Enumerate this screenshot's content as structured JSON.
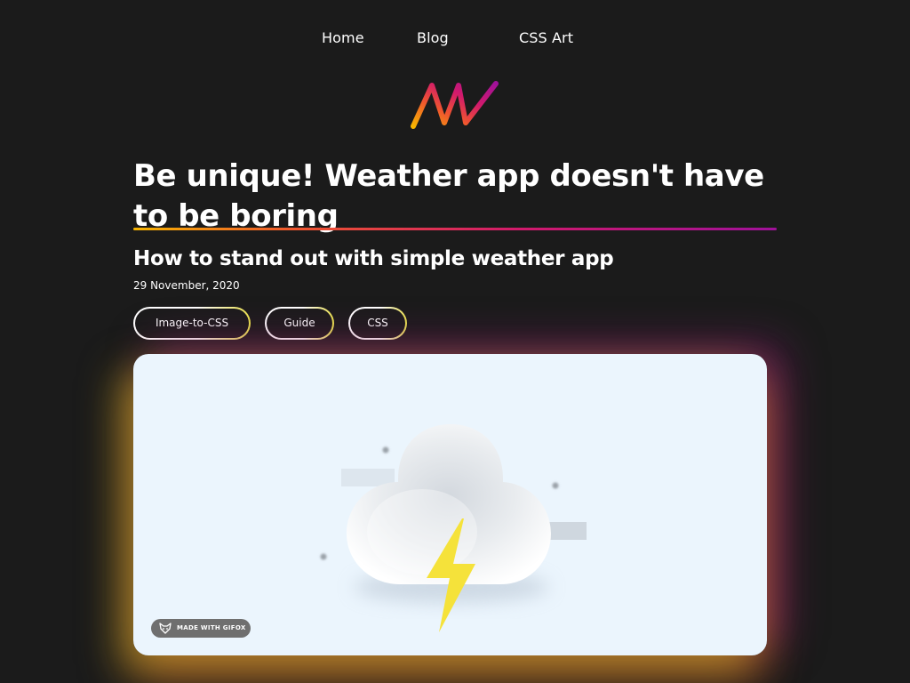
{
  "nav": {
    "items": [
      {
        "label": "Home"
      },
      {
        "label": "Blog"
      },
      {
        "label": "CSS Art"
      }
    ]
  },
  "logo": {
    "name": "logo-icon",
    "gradient": [
      "#f7b500",
      "#f0562e",
      "#d21a6c",
      "#a0119a"
    ]
  },
  "article": {
    "title": "Be unique! Weather app doesn't have to be boring",
    "subtitle": "How to stand out with simple weather app",
    "date": "29 November, 2020",
    "tags": [
      {
        "label": "Image-to-CSS"
      },
      {
        "label": "Guide"
      },
      {
        "label": "CSS"
      }
    ]
  },
  "hero": {
    "background": "#ebf5fd",
    "badge_label": "MADE WITH GIFOX",
    "icons": [
      "cloud-icon",
      "lightning-bolt-icon",
      "fox-icon"
    ]
  },
  "colors": {
    "page_background": "#1b1b1b",
    "text": "#ffffff",
    "accent_yellow": "#f7b500",
    "accent_orange": "#f0562e",
    "accent_magenta": "#d21a6c",
    "accent_purple": "#a0119a",
    "bolt_yellow": "#f5e23a"
  }
}
